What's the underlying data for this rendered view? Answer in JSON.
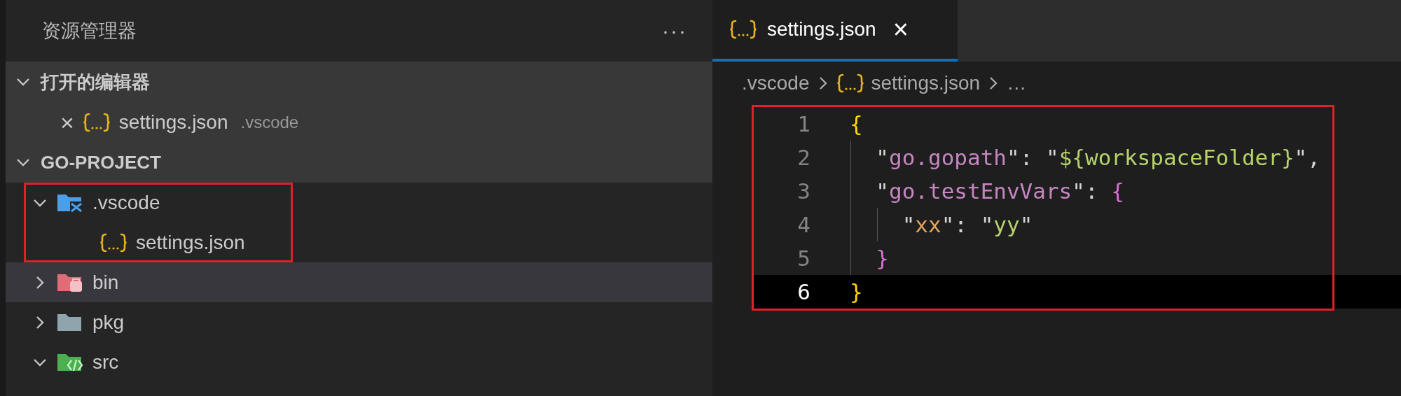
{
  "sidebar": {
    "title": "资源管理器",
    "more": "···",
    "sections": [
      {
        "title": "打开的编辑器",
        "expanded": true,
        "kind": "open-editors",
        "items": [
          {
            "name": "settings.json",
            "description": ".vscode",
            "close": "×"
          }
        ]
      },
      {
        "title": "GO-PROJECT",
        "expanded": true,
        "kind": "tree",
        "items": [
          {
            "name": ".vscode",
            "kind": "config-folder",
            "expanded": true,
            "outlined": true,
            "hovered": false,
            "children": [
              {
                "name": "settings.json",
                "kind": "json-file",
                "hovered": false
              }
            ]
          },
          {
            "name": "bin",
            "kind": "binary-folder",
            "expanded": false,
            "outlined": false,
            "hovered": true
          },
          {
            "name": "pkg",
            "kind": "folder",
            "expanded": false,
            "outlined": false,
            "hovered": false
          },
          {
            "name": "src",
            "kind": "source-folder",
            "expanded": true,
            "outlined": false,
            "hovered": false
          }
        ]
      }
    ]
  },
  "editor": {
    "tabs": [
      {
        "label": "settings.json",
        "selected": true,
        "close": "×"
      }
    ],
    "breadcrumb": [
      {
        "label": ".vscode",
        "icon": false
      },
      {
        "label": "settings.json",
        "icon": true
      },
      {
        "label": "…",
        "icon": false
      }
    ],
    "outlined": true,
    "lines": [
      {
        "number": "1",
        "current": false,
        "nested": false,
        "tokens": [
          {
            "kind": "brace1",
            "text": "{"
          }
        ]
      },
      {
        "number": "2",
        "current": false,
        "nested": false,
        "tokens": [
          {
            "kind": "quote",
            "text": "\""
          },
          {
            "kind": "key",
            "text": "go.gopath"
          },
          {
            "kind": "quote",
            "text": "\""
          },
          {
            "kind": "punct",
            "text": ": "
          },
          {
            "kind": "quote",
            "text": "\""
          },
          {
            "kind": "string",
            "text": "${workspaceFolder}"
          },
          {
            "kind": "quote",
            "text": "\""
          },
          {
            "kind": "punct",
            "text": ","
          }
        ]
      },
      {
        "number": "3",
        "current": false,
        "nested": false,
        "tokens": [
          {
            "kind": "quote",
            "text": "\""
          },
          {
            "kind": "key",
            "text": "go.testEnvVars"
          },
          {
            "kind": "quote",
            "text": "\""
          },
          {
            "kind": "punct",
            "text": ": "
          },
          {
            "kind": "brace2",
            "text": "{"
          }
        ]
      },
      {
        "number": "4",
        "current": false,
        "nested": true,
        "tokens": [
          {
            "kind": "quote",
            "text": "\""
          },
          {
            "kind": "key2",
            "text": "xx"
          },
          {
            "kind": "quote",
            "text": "\""
          },
          {
            "kind": "punct",
            "text": ": "
          },
          {
            "kind": "quote",
            "text": "\""
          },
          {
            "kind": "string",
            "text": "yy"
          },
          {
            "kind": "quote",
            "text": "\""
          }
        ]
      },
      {
        "number": "5",
        "current": false,
        "nested": false,
        "tokens": [
          {
            "kind": "brace2",
            "text": "}"
          }
        ]
      },
      {
        "number": "6",
        "current": true,
        "nested": false,
        "tokens": [
          {
            "kind": "brace1",
            "text": "}"
          }
        ]
      }
    ]
  }
}
